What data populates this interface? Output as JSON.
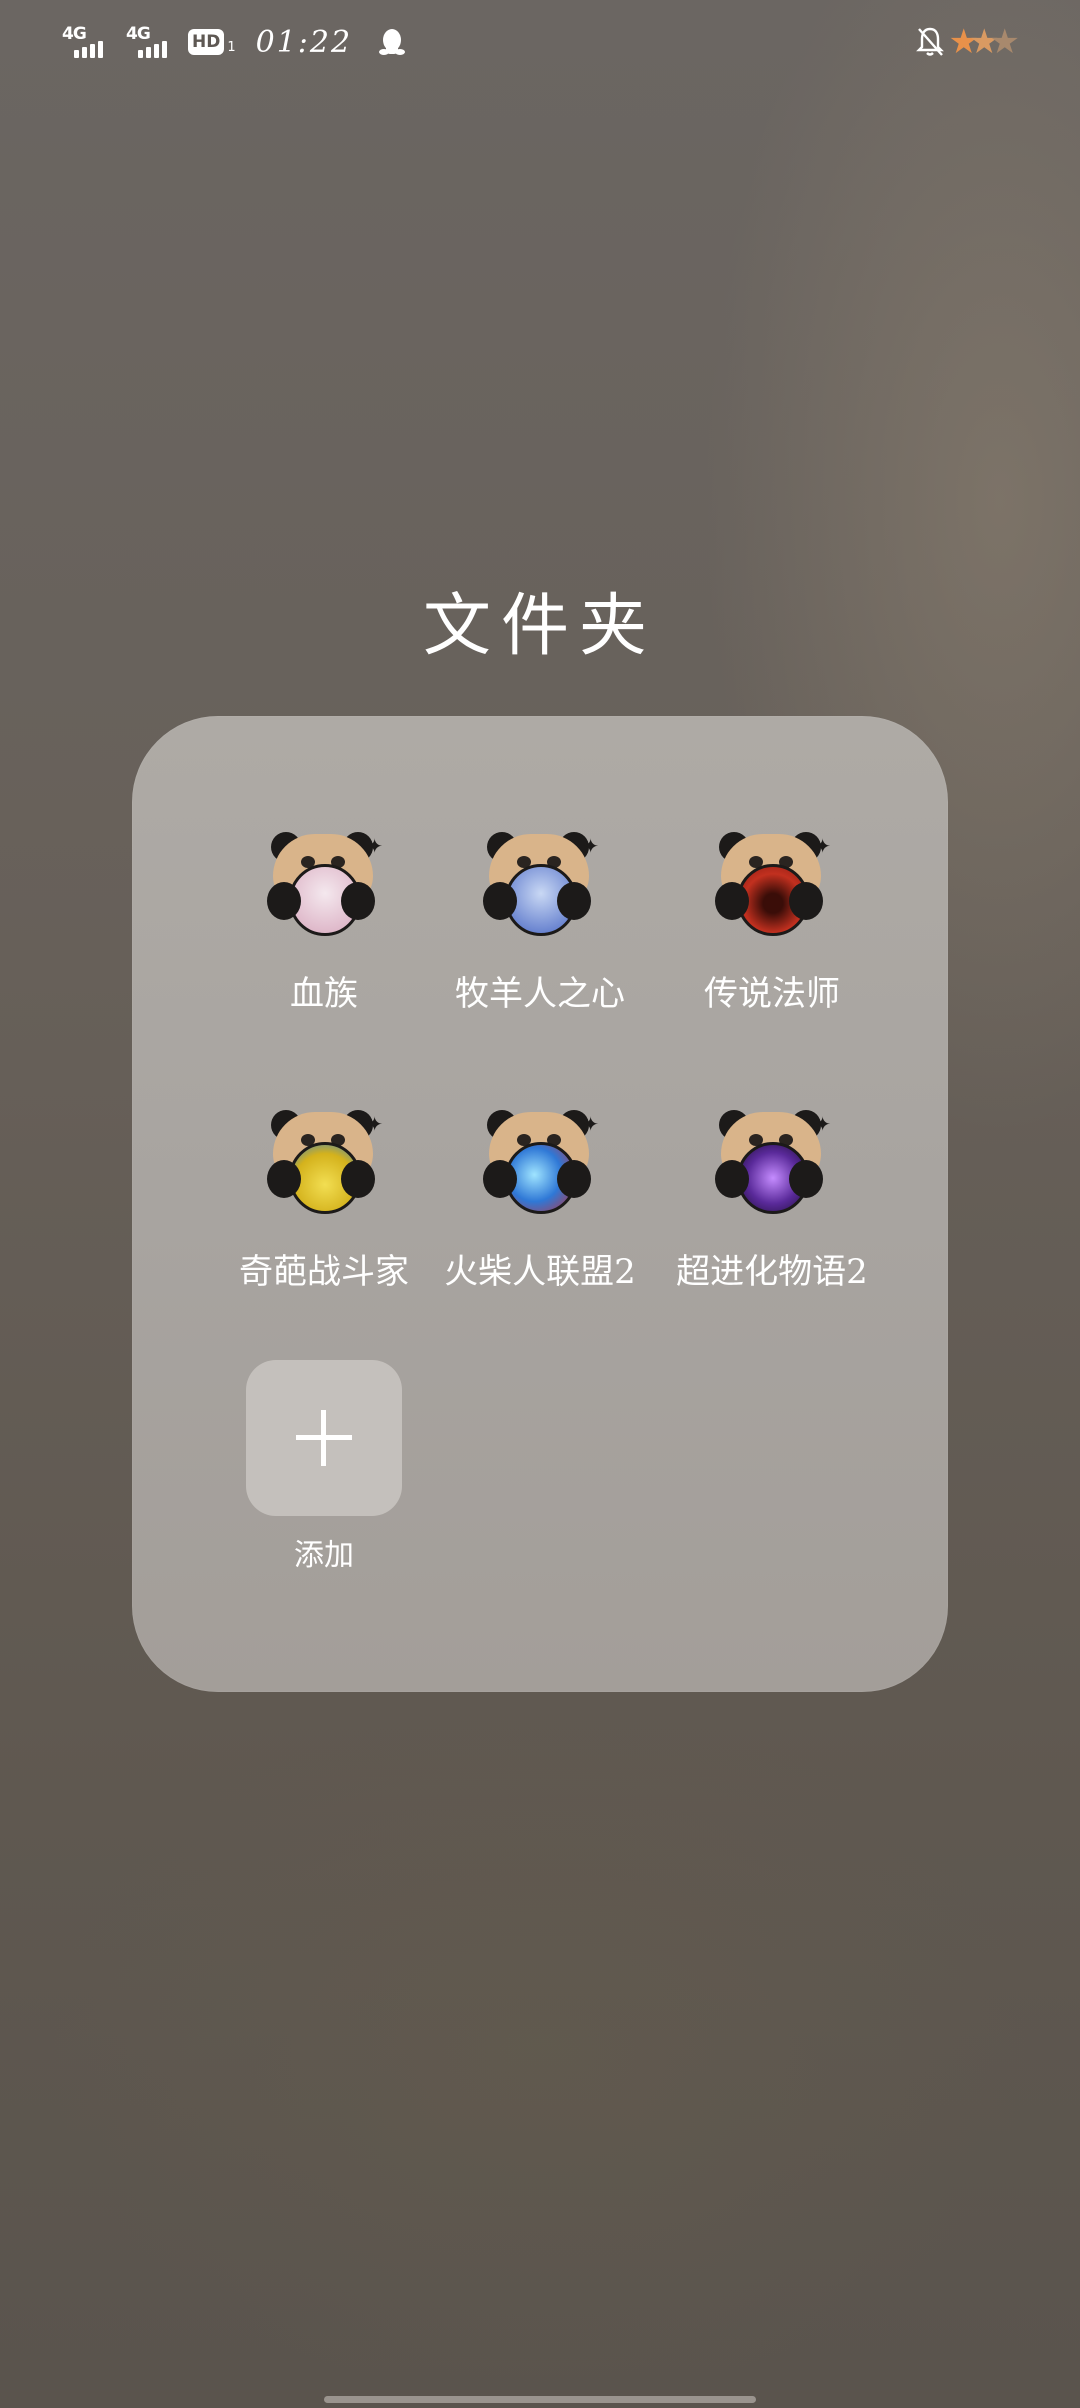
{
  "status_bar": {
    "sim1_network": "4G",
    "sim2_network": "4G",
    "hd_label": "HD",
    "hd_sub": "1",
    "time": "01:22",
    "icons": [
      "signal-icon",
      "signal-icon",
      "hd-volte-icon",
      "qq-penguin-icon",
      "bell-off-icon",
      "stars-icon"
    ]
  },
  "folder": {
    "title": "文件夹",
    "apps": [
      {
        "label": "血族",
        "icon": "panda-game-icon",
        "badge_color": "#e8d6e0"
      },
      {
        "label": "牧羊人之心",
        "icon": "panda-game-icon",
        "badge_color": "#6f8fd8"
      },
      {
        "label": "传说法师",
        "icon": "panda-game-icon",
        "badge_color": "#b3281e"
      },
      {
        "label": "奇葩战斗家",
        "icon": "panda-game-icon",
        "badge_color": "#e6c93a"
      },
      {
        "label": "火柴人联盟2",
        "icon": "panda-game-icon",
        "badge_color": "#2f78d6"
      },
      {
        "label": "超进化物语2",
        "icon": "panda-game-icon",
        "badge_color": "#5a2a9a"
      }
    ],
    "add_label": "添加"
  },
  "colors": {
    "panel": "#aaa6a1",
    "add_tile": "#c4c0bc",
    "star_orange": "#e8914a",
    "star_muted": "#b08a6a"
  }
}
